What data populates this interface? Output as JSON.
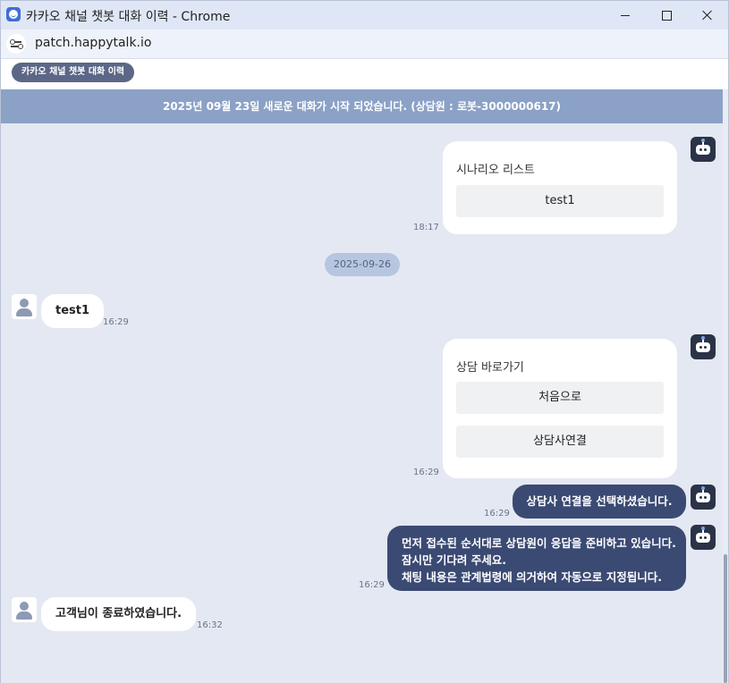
{
  "window": {
    "title": "카카오 채널 챗봇 대화 이력 - Chrome",
    "minimize_icon": "minimize-icon",
    "maximize_icon": "maximize-icon",
    "close_icon": "close-icon"
  },
  "address": {
    "url": "patch.happytalk.io",
    "site_icon": "site-settings-icon"
  },
  "header": {
    "chip_label": "카카오 채널 챗봇 대화 이력"
  },
  "chat": {
    "banner": "2025년 09월 23일 새로운 대화가 시작 되었습니다. (상담원 : 로봇-3000000617)",
    "date_divider": "2025-09-26",
    "messages": [
      {
        "sender": "bot",
        "type": "card",
        "title": "시나리오 리스트",
        "buttons": [
          "test1"
        ],
        "time": "18:17"
      },
      {
        "sender": "user",
        "type": "text",
        "text": "test1",
        "time": "16:29"
      },
      {
        "sender": "bot",
        "type": "card",
        "title": "상담 바로가기",
        "buttons": [
          "처음으로",
          "상담사연결"
        ],
        "time": "16:29"
      },
      {
        "sender": "bot",
        "type": "text",
        "lines": [
          "상담사 연결을 선택하셨습니다."
        ],
        "time": "16:29"
      },
      {
        "sender": "bot",
        "type": "text",
        "lines": [
          "먼저 접수된 순서대로 상담원이 응답을 준비하고 있습니다.",
          "잠시만 기다려 주세요.",
          "채팅 내용은 관계법령에 의거하여 자동으로 지정됩니다."
        ],
        "time": "16:29"
      },
      {
        "sender": "user",
        "type": "text",
        "text": "고객님이 종료하였습니다.",
        "time": "16:32"
      }
    ]
  },
  "colors": {
    "banner": "#8ba1c6",
    "chat_bg": "#e4e8f2",
    "bot_bubble": "#3b4a73",
    "chip": "#5c6787"
  }
}
